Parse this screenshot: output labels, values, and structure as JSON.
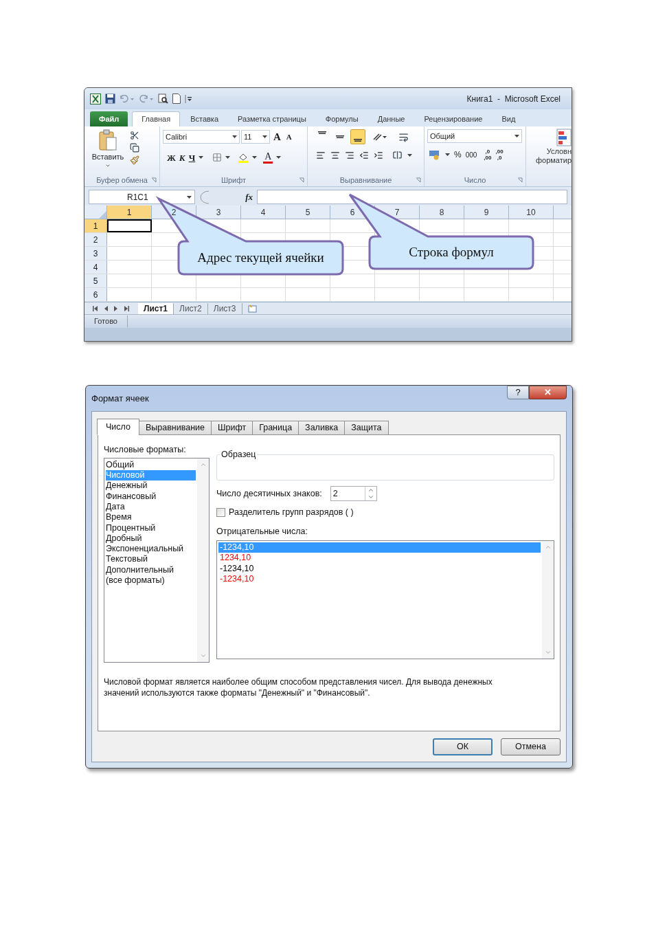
{
  "excel": {
    "title": "Книга1  -  Microsoft Excel",
    "ribbon_tabs": [
      {
        "label": "Файл",
        "kind": "file",
        "selected": false
      },
      {
        "label": "Главная",
        "kind": "tab",
        "selected": true
      },
      {
        "label": "Вставка",
        "kind": "tab",
        "selected": false
      },
      {
        "label": "Разметка страницы",
        "kind": "tab",
        "selected": false
      },
      {
        "label": "Формулы",
        "kind": "tab",
        "selected": false
      },
      {
        "label": "Данные",
        "kind": "tab",
        "selected": false
      },
      {
        "label": "Рецензирование",
        "kind": "tab",
        "selected": false
      },
      {
        "label": "Вид",
        "kind": "tab",
        "selected": false
      }
    ],
    "clipboard": {
      "paste": "Вставить",
      "group": "Буфер обмена"
    },
    "font": {
      "name": "Calibri",
      "size": "11",
      "grow": "A",
      "shrink": "A",
      "bold": "Ж",
      "italic": "К",
      "underline": "Ч",
      "font_color_letter": "A",
      "group": "Шрифт"
    },
    "alignment": {
      "vertical": [
        {
          "selected": false
        },
        {
          "selected": false
        },
        {
          "selected": true
        }
      ],
      "group": "Выравнивание"
    },
    "number": {
      "format": "Общий",
      "percent": "%",
      "thousands": "000",
      "decimal_up": [
        ",0",
        ",00"
      ],
      "decimal_down": [
        ",00",
        ",0"
      ],
      "group": "Число"
    },
    "styles": {
      "label_line_1": "Условн",
      "label_line_2": "форматир"
    },
    "name_box": "R1C1",
    "fx": "fx",
    "columns": [
      {
        "label": "1",
        "selected": true
      },
      {
        "label": "2",
        "selected": false
      },
      {
        "label": "3",
        "selected": false
      },
      {
        "label": "4",
        "selected": false
      },
      {
        "label": "5",
        "selected": false
      },
      {
        "label": "6",
        "selected": false
      },
      {
        "label": "7",
        "selected": false
      },
      {
        "label": "8",
        "selected": false
      },
      {
        "label": "9",
        "selected": false
      },
      {
        "label": "10",
        "selected": false
      }
    ],
    "rows": [
      {
        "label": "1",
        "selected": true
      },
      {
        "label": "2",
        "selected": false
      },
      {
        "label": "3",
        "selected": false
      },
      {
        "label": "4",
        "selected": false
      },
      {
        "label": "5",
        "selected": false
      },
      {
        "label": "6",
        "selected": false
      }
    ],
    "callouts": [
      {
        "text": "Адрес текущей ячейки"
      },
      {
        "text": "Строка формул"
      }
    ],
    "sheets": [
      {
        "label": "Лист1",
        "selected": true
      },
      {
        "label": "Лист2",
        "selected": false
      },
      {
        "label": "Лист3",
        "selected": false
      }
    ],
    "status": "Готово"
  },
  "dialog": {
    "title": "Формат ячеек",
    "help": "?",
    "close": "✕",
    "tabs": [
      {
        "label": "Число",
        "selected": true
      },
      {
        "label": "Выравнивание",
        "selected": false
      },
      {
        "label": "Шрифт",
        "selected": false
      },
      {
        "label": "Граница",
        "selected": false
      },
      {
        "label": "Заливка",
        "selected": false
      },
      {
        "label": "Защита",
        "selected": false
      }
    ],
    "formats_label": "Числовые форматы:",
    "formats": [
      {
        "label": "Общий",
        "selected": false
      },
      {
        "label": "Числовой",
        "selected": true
      },
      {
        "label": "Денежный",
        "selected": false
      },
      {
        "label": "Финансовый",
        "selected": false
      },
      {
        "label": "Дата",
        "selected": false
      },
      {
        "label": "Время",
        "selected": false
      },
      {
        "label": "Процентный",
        "selected": false
      },
      {
        "label": "Дробный",
        "selected": false
      },
      {
        "label": "Экспоненциальный",
        "selected": false
      },
      {
        "label": "Текстовый",
        "selected": false
      },
      {
        "label": "Дополнительный",
        "selected": false
      },
      {
        "label": "(все форматы)",
        "selected": false
      }
    ],
    "sample_label": "Образец",
    "decimals_label": "Число десятичных знаков:",
    "decimals_value": "2",
    "separator": {
      "label": "Разделитель групп разрядов ( )",
      "checked": false
    },
    "negatives_label": "Отрицательные числа:",
    "negatives": [
      {
        "text": "-1234,10",
        "selected": true
      },
      {
        "text": "1234,10",
        "color": "#ff0000",
        "selected": false
      },
      {
        "text": "-1234,10",
        "color": "#000000",
        "selected": false
      },
      {
        "text": "-1234,10",
        "color": "#ff0000",
        "selected": false
      }
    ],
    "description": "Числовой формат является наиболее общим способом представления чисел. Для вывода денежных значений используются также форматы \"Денежный\" и \"Финансовый\".",
    "buttons": [
      {
        "label": "ОК",
        "kind": "default"
      },
      {
        "label": "Отмена",
        "kind": "normal"
      }
    ]
  }
}
